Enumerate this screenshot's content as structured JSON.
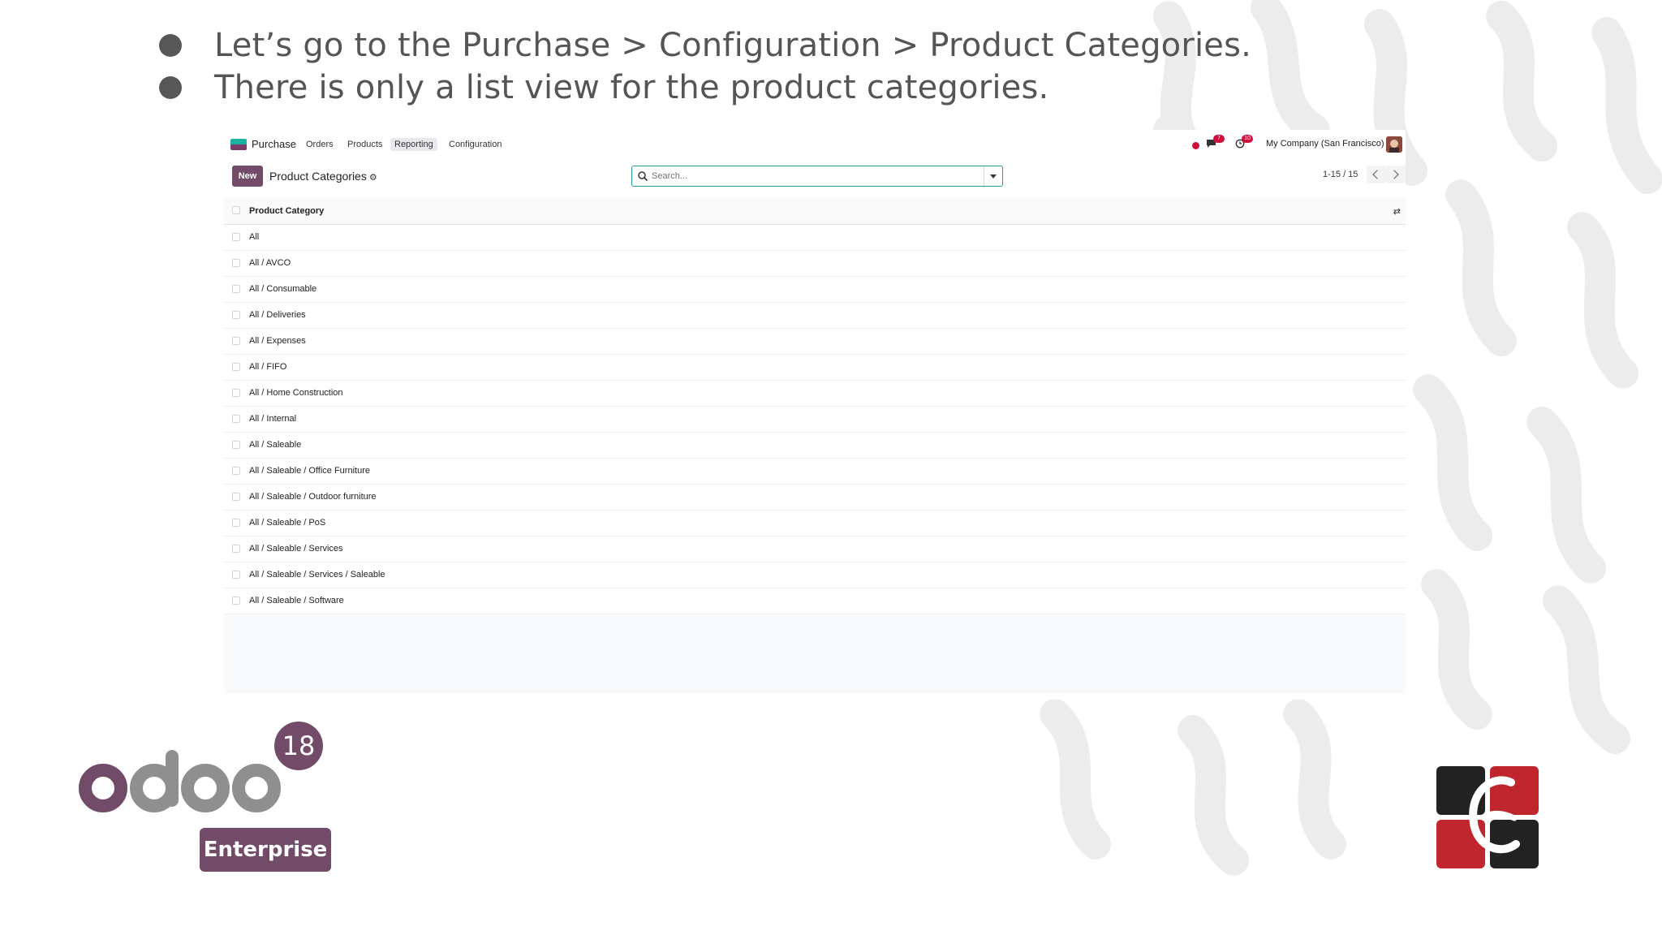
{
  "slide": {
    "bullets": [
      "Let’s go to the Purchase > Configuration > Product Categories.",
      "There is only a list view for the product categories."
    ]
  },
  "app": {
    "name": "Purchase",
    "menu": [
      "Orders",
      "Products",
      "Reporting",
      "Configuration"
    ],
    "active_menu": "Reporting",
    "systray": {
      "messages_badge": "7",
      "activities_badge": "10",
      "company": "My Company (San Francisco)"
    },
    "control": {
      "new_label": "New",
      "breadcrumb": "Product Categories",
      "search_placeholder": "Search...",
      "pager": "1-15 / 15"
    },
    "list": {
      "column": "Product Category",
      "rows": [
        "All",
        "All / AVCO",
        "All / Consumable",
        "All / Deliveries",
        "All / Expenses",
        "All / FIFO",
        "All / Home Construction",
        "All / Internal",
        "All / Saleable",
        "All / Saleable / Office Furniture",
        "All / Saleable / Outdoor furniture",
        "All / Saleable / PoS",
        "All / Saleable / Services",
        "All / Saleable / Services / Saleable",
        "All / Saleable / Software"
      ]
    }
  },
  "branding": {
    "odoo_version": "18",
    "edition": "Enterprise"
  },
  "colors": {
    "brand": "#714b67",
    "accent_teal": "#2a9c98",
    "badge_red": "#d20f3c"
  }
}
